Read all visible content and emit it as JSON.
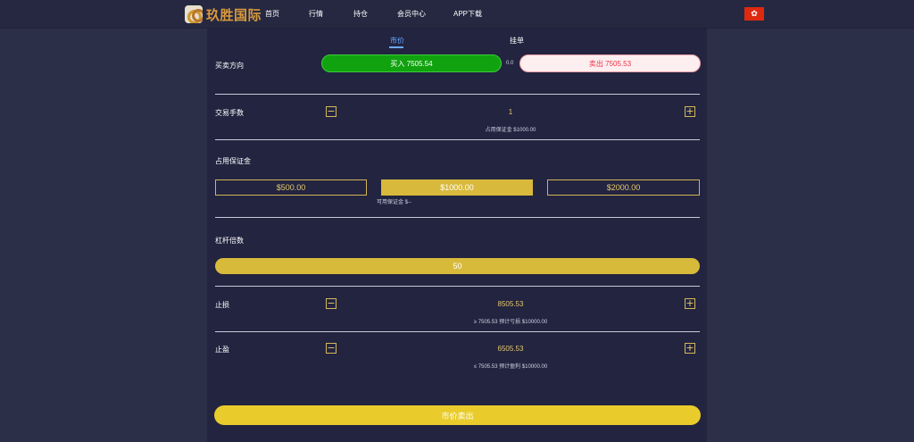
{
  "nav": {
    "logo_text": "玖胜国际",
    "items": [
      "首页",
      "行情",
      "持仓",
      "会员中心",
      "APP下载"
    ],
    "flag_symbol": "✿",
    "flag_color": "#de2910"
  },
  "tabs": {
    "market": "市价",
    "limit": "挂单"
  },
  "direction": {
    "label": "买卖方向",
    "buy_label": "买入 7505.54",
    "spread": "0.0",
    "sell_label": "卖出 7505.53"
  },
  "lots": {
    "label": "交易手数",
    "value": "1",
    "hint": "占用保证金 $1000.00"
  },
  "margin": {
    "label": "占用保证金",
    "options": [
      "$500.00",
      "$1000.00",
      "$2000.00"
    ],
    "selected": "$1000.00",
    "available": "可用保证金 $--"
  },
  "leverage": {
    "label": "杠杆倍数",
    "value": "50"
  },
  "stop_loss": {
    "label": "止损",
    "value": "8505.53",
    "hint": "≥ 7505.53 预计亏损 $10000.00"
  },
  "take_profit": {
    "label": "止盈",
    "value": "6505.53",
    "hint": "≤ 7505.53 预计盈利 $10000.00"
  },
  "stepper": {
    "minus": "−",
    "plus": "+"
  },
  "submit": {
    "label": "市价卖出"
  },
  "colors": {
    "buy": "#11a30f",
    "sell_text": "#ea3443",
    "gold": "#d9b93c",
    "submit": "#e9cc2b",
    "active_tab": "#6ea9ff"
  }
}
